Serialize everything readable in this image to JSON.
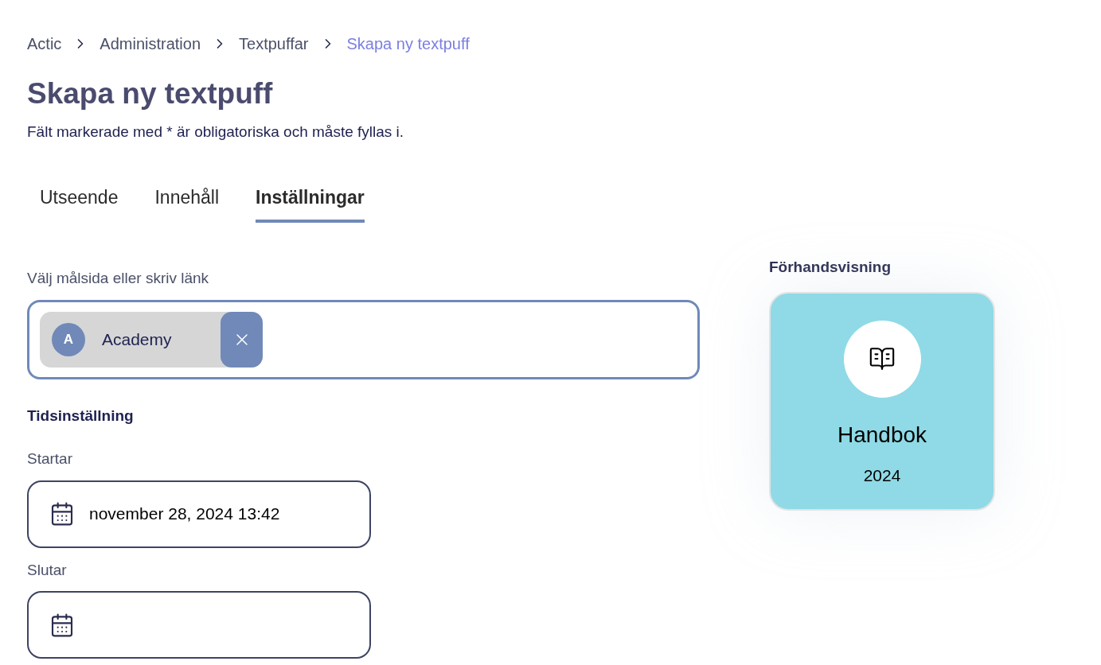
{
  "breadcrumb": [
    {
      "label": "Actic",
      "selected": false
    },
    {
      "label": "Administration",
      "selected": false
    },
    {
      "label": "Textpuffar",
      "selected": false
    },
    {
      "label": "Skapa ny textpuff",
      "selected": true
    }
  ],
  "title": "Skapa ny textpuff",
  "subtitle": "Fält markerade med * är obligatoriska och måste fyllas i.",
  "tabs": [
    {
      "label": "Utseende",
      "selected": false
    },
    {
      "label": "Innehåll",
      "selected": false
    },
    {
      "label": "Inställningar",
      "selected": true
    }
  ],
  "target": {
    "label": "Välj målsida eller skriv länk",
    "chips": [
      {
        "initial": "A",
        "label": "Academy"
      }
    ]
  },
  "schedule": {
    "title": "Tidsinställning",
    "fields": [
      {
        "label": "Startar",
        "value": "november 28, 2024 13:42"
      },
      {
        "label": "Slutar"
      }
    ]
  },
  "preview": {
    "title": "Förhandsvisning",
    "card": {
      "heading": "Handbok",
      "subheading": "2024",
      "color": "#8fdae6"
    }
  }
}
